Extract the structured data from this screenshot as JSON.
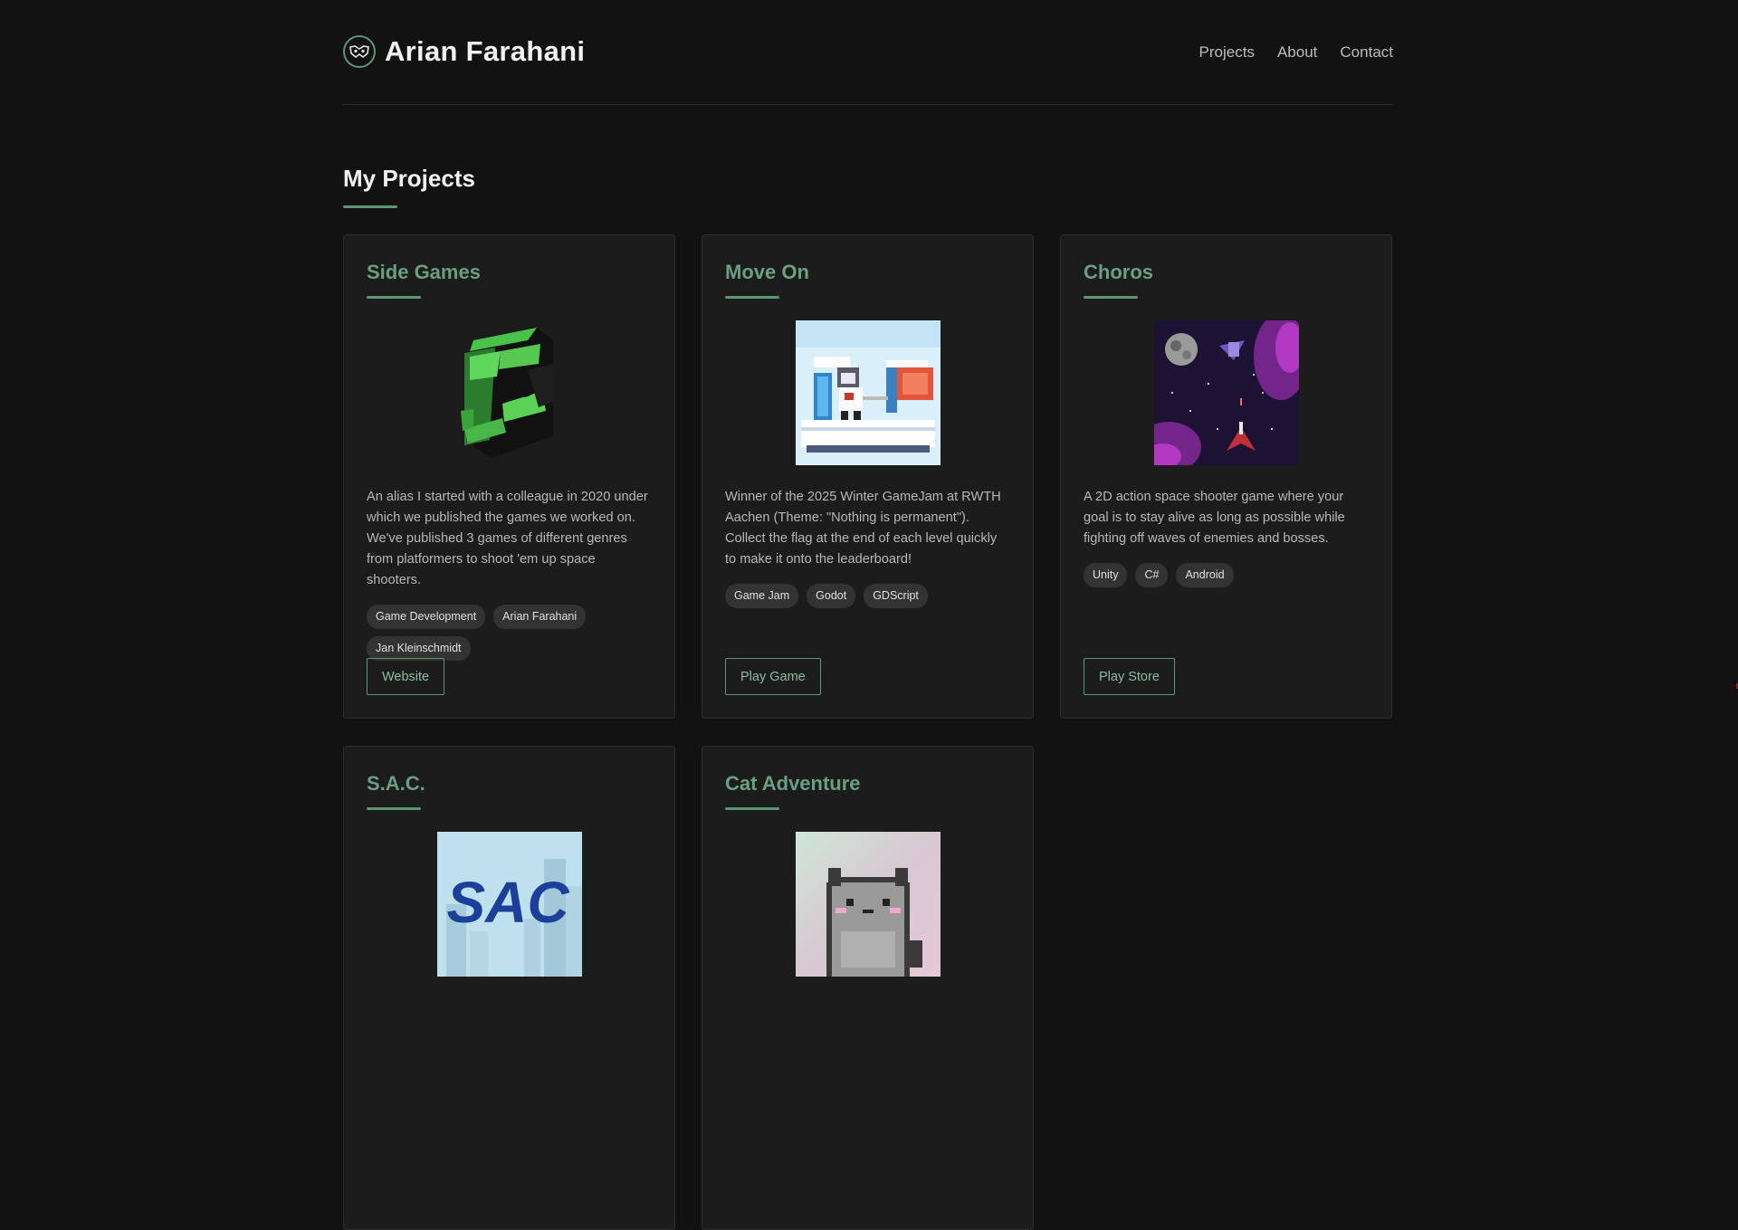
{
  "header": {
    "name": "Arian Farahani",
    "logo_icon": "fox-mask-icon",
    "nav": [
      "Projects",
      "About",
      "Contact"
    ]
  },
  "section_title": "My Projects",
  "accent": "#5e9577",
  "projects": [
    {
      "title": "Side Games",
      "image_icon": "side-games-logo",
      "description": "An alias I started with a colleague in 2020 under which we published the games we worked on. We've published 3 games of different genres from platformers to shoot 'em up space shooters.",
      "tags": [
        "Game Development",
        "Arian Farahani",
        "Jan Kleinschmidt"
      ],
      "button": "Website"
    },
    {
      "title": "Move On",
      "image_icon": "pixel-knight-cloud-image",
      "description": "Winner of the 2025 Winter GameJam at RWTH Aachen (Theme: \"Nothing is permanent\"). Collect the flag at the end of each level quickly to make it onto the leaderboard!",
      "tags": [
        "Game Jam",
        "Godot",
        "GDScript"
      ],
      "button": "Play Game"
    },
    {
      "title": "Choros",
      "image_icon": "space-shooter-image",
      "description": "A 2D action space shooter game where your goal is to stay alive as long as possible while fighting off waves of enemies and bosses.",
      "tags": [
        "Unity",
        "C#",
        "Android"
      ],
      "button": "Play Store"
    },
    {
      "title": "S.A.C.",
      "image_icon": "sac-logo-image",
      "image_text": "SAC"
    },
    {
      "title": "Cat Adventure",
      "image_icon": "pixel-cat-image"
    }
  ]
}
